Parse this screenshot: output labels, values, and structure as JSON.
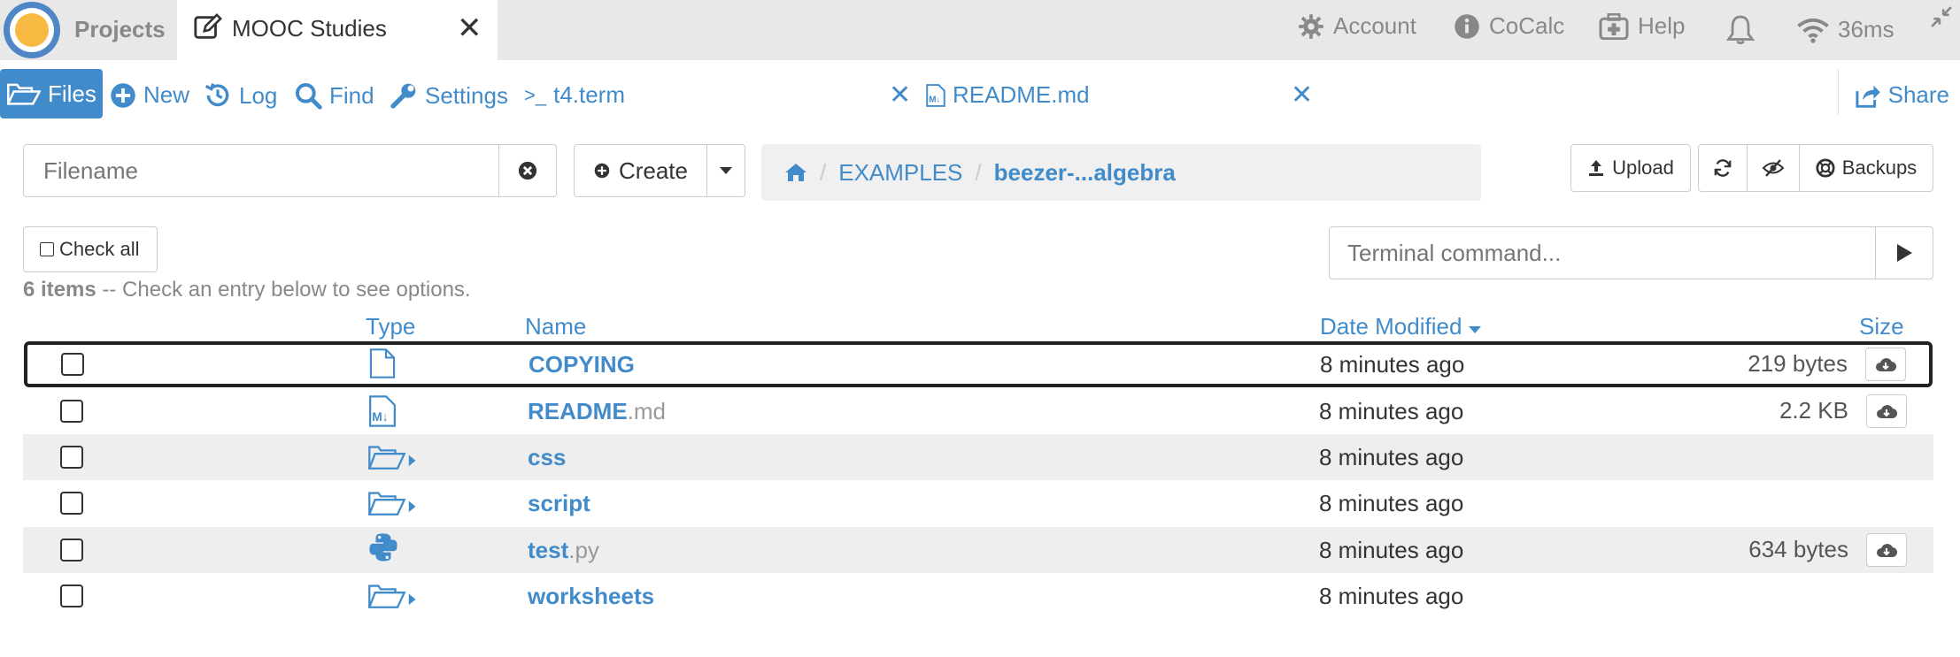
{
  "topbar": {
    "projects_label": "Projects",
    "project_tab_label": "MOOC Studies",
    "account_label": "Account",
    "cocalc_label": "CoCalc",
    "help_label": "Help",
    "ping_label": "36ms"
  },
  "filebar": {
    "files_label": "Files",
    "new_label": "New",
    "log_label": "Log",
    "find_label": "Find",
    "settings_label": "Settings",
    "terminal_tab_prefix": ">_",
    "terminal_tab_label": "t4.term",
    "readme_tab_label": "README.md",
    "share_label": "Share"
  },
  "controls": {
    "filename_placeholder": "Filename",
    "create_label": "Create",
    "breadcrumb": [
      "EXAMPLES",
      "beezer-...algebra"
    ],
    "upload_label": "Upload",
    "backups_label": "Backups",
    "check_all_label": "Check all",
    "terminal_placeholder": "Terminal command...",
    "status_count": "6 items",
    "status_text": " -- Check an entry below to see options."
  },
  "table": {
    "headers": {
      "type": "Type",
      "name": "Name",
      "date": "Date Modified",
      "size": "Size"
    },
    "rows": [
      {
        "name": "COPYING",
        "ext": "",
        "type": "file-icon",
        "date": "8 minutes ago",
        "size": "219 bytes"
      },
      {
        "name": "README",
        "ext": ".md",
        "type": "markdown-icon",
        "date": "8 minutes ago",
        "size": "2.2 KB"
      },
      {
        "name": "css",
        "ext": "",
        "type": "folder-icon",
        "date": "8 minutes ago",
        "size": ""
      },
      {
        "name": "script",
        "ext": "",
        "type": "folder-icon",
        "date": "8 minutes ago",
        "size": ""
      },
      {
        "name": "test",
        "ext": ".py",
        "type": "python-icon",
        "date": "8 minutes ago",
        "size": "634 bytes"
      },
      {
        "name": "worksheets",
        "ext": "",
        "type": "folder-icon",
        "date": "8 minutes ago",
        "size": ""
      }
    ]
  },
  "colors": {
    "accent": "#428bca",
    "topbar_bg": "#e8e8e8",
    "stripe": "#eeeeee"
  }
}
